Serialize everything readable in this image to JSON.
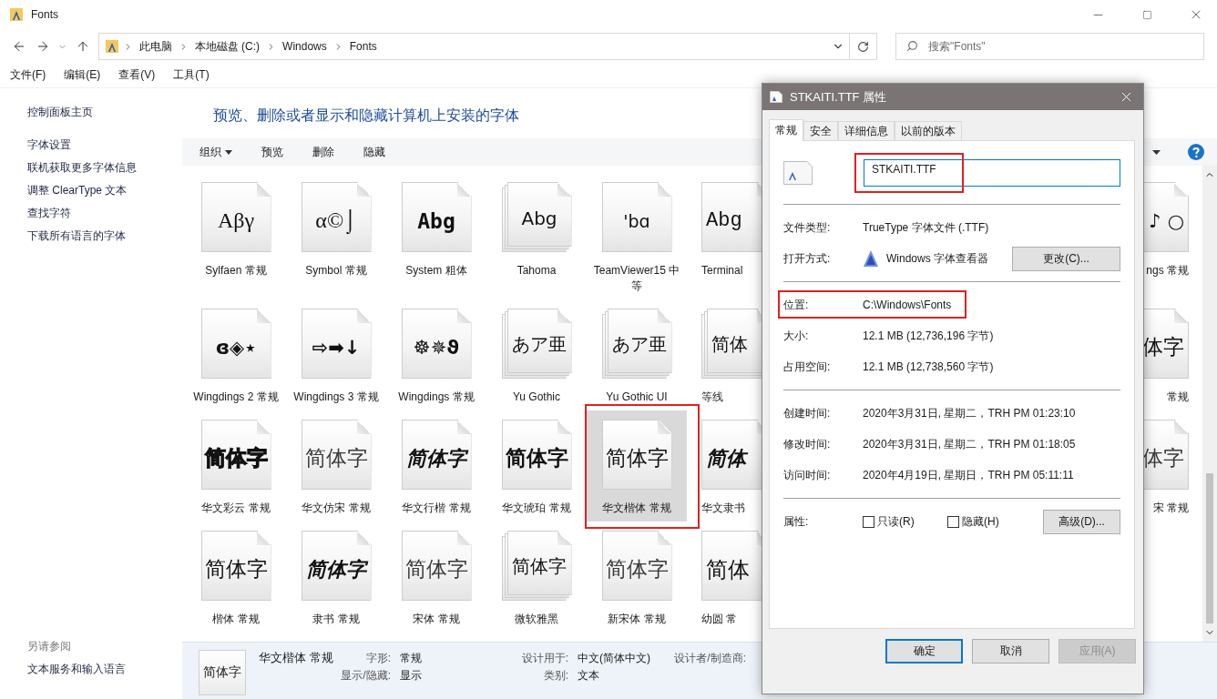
{
  "window": {
    "title": "Fonts"
  },
  "nav": {
    "breadcrumbs": [
      "此电脑",
      "本地磁盘 (C:)",
      "Windows",
      "Fonts"
    ],
    "search": {
      "placeholder": "搜索\"Fonts\""
    }
  },
  "menu": [
    "文件(F)",
    "编辑(E)",
    "查看(V)",
    "工具(T)"
  ],
  "sidebar": {
    "home": "控制面板主页",
    "links": [
      "字体设置",
      "联机获取更多字体信息",
      "调整 ClearType 文本",
      "查找字符",
      "下载所有语言的字体"
    ],
    "see_also": {
      "heading": "另请参阅",
      "links": [
        "文本服务和输入语言"
      ]
    }
  },
  "heading": "预览、删除或者显示和隐藏计算机上安装的字体",
  "toolbar": {
    "organize": "组织",
    "buttons": [
      "预览",
      "删除",
      "隐藏"
    ]
  },
  "font_rows": [
    {
      "items": [
        {
          "kind": "full",
          "label": "Sylfaen 常规",
          "sample": "Aβγ",
          "stacked": false,
          "selected": false,
          "outlined": false
        },
        {
          "kind": "full",
          "label": "Symbol 常规",
          "sample": "α©⌡",
          "stacked": false,
          "selected": false,
          "outlined": false
        },
        {
          "kind": "full",
          "label": "System 粗体",
          "sample": "Abg",
          "stacked": false,
          "selected": false,
          "outlined": false
        },
        {
          "kind": "full",
          "label": "Tahoma",
          "sample": "Abg",
          "stacked": true,
          "selected": false,
          "outlined": false
        },
        {
          "kind": "full",
          "label": "TeamViewer15 中等",
          "sample": "'bɑ",
          "stacked": false,
          "selected": false,
          "outlined": false
        },
        {
          "kind": "cut_right",
          "label": "Terminal",
          "sample": "Abg",
          "stacked": false,
          "selected": false,
          "outlined": false
        },
        {
          "kind": "cut_left",
          "label": "ngs 常规",
          "sample": "♪ ○",
          "stacked": false,
          "selected": false,
          "outlined": false
        }
      ]
    },
    {
      "items": [
        {
          "kind": "full",
          "label": "Wingdings 2 常规",
          "sample": "ɞ◈⋆",
          "stacked": false,
          "selected": false,
          "outlined": false
        },
        {
          "kind": "full",
          "label": "Wingdings 3 常规",
          "sample": "⇨➡↓",
          "stacked": false,
          "selected": false,
          "outlined": false
        },
        {
          "kind": "full",
          "label": "Wingdings 常规",
          "sample": "☸✵ϑ",
          "stacked": false,
          "selected": false,
          "outlined": false
        },
        {
          "kind": "full",
          "label": "Yu Gothic",
          "sample": "あア亜",
          "stacked": true,
          "selected": false,
          "outlined": false
        },
        {
          "kind": "full",
          "label": "Yu Gothic UI",
          "sample": "あア亜",
          "stacked": true,
          "selected": false,
          "outlined": false
        },
        {
          "kind": "cut_right",
          "label": "等线",
          "sample": "简体",
          "stacked": true,
          "selected": false,
          "outlined": false
        },
        {
          "kind": "cut_left",
          "label": "常规",
          "sample": "体字",
          "stacked": false,
          "selected": false,
          "outlined": false
        }
      ]
    },
    {
      "items": [
        {
          "kind": "full",
          "label": "华文彩云 常规",
          "sample": "简体字",
          "stacked": false,
          "selected": false,
          "outlined": false
        },
        {
          "kind": "full",
          "label": "华文仿宋 常规",
          "sample": "简体字",
          "stacked": false,
          "selected": false,
          "outlined": false
        },
        {
          "kind": "full",
          "label": "华文行楷 常规",
          "sample": "简体字",
          "stacked": false,
          "selected": false,
          "outlined": false
        },
        {
          "kind": "full",
          "label": "华文琥珀 常规",
          "sample": "简体字",
          "stacked": false,
          "selected": false,
          "outlined": false
        },
        {
          "kind": "full",
          "label": "华文楷体 常规",
          "sample": "简体字",
          "stacked": false,
          "selected": true,
          "outlined": true
        },
        {
          "kind": "cut_right",
          "label": "华文隶书",
          "sample": "简体",
          "stacked": false,
          "selected": false,
          "outlined": false
        },
        {
          "kind": "cut_left",
          "label": "宋 常规",
          "sample": "体字",
          "stacked": false,
          "selected": false,
          "outlined": false
        }
      ]
    },
    {
      "items": [
        {
          "kind": "full",
          "label": "楷体 常规",
          "sample": "简体字",
          "stacked": false,
          "selected": false,
          "outlined": false
        },
        {
          "kind": "full",
          "label": "隶书 常规",
          "sample": "简体字",
          "stacked": false,
          "selected": false,
          "outlined": false
        },
        {
          "kind": "full",
          "label": "宋体 常规",
          "sample": "简体字",
          "stacked": false,
          "selected": false,
          "outlined": false
        },
        {
          "kind": "full",
          "label": "微软雅黑",
          "sample": "简体字",
          "stacked": true,
          "selected": false,
          "outlined": false
        },
        {
          "kind": "full",
          "label": "新宋体 常规",
          "sample": "简体字",
          "stacked": false,
          "selected": false,
          "outlined": false
        },
        {
          "kind": "cut_right",
          "label": "幼圆 常",
          "sample": "简体",
          "stacked": false,
          "selected": false,
          "outlined": false
        }
      ]
    }
  ],
  "details": {
    "sample": "简体字",
    "name": "华文楷体 常规",
    "groups": [
      [
        {
          "label": "字形:",
          "value": "常规"
        },
        {
          "label": "显示/隐藏:",
          "value": "显示"
        }
      ],
      [
        {
          "label": "设计用于:",
          "value": "中文(简体中文)"
        },
        {
          "label": "类别:",
          "value": "文本"
        }
      ],
      [
        {
          "label": "设计者/制造商:"
        }
      ]
    ]
  },
  "dialog": {
    "title": "STKAITI.TTF 属性",
    "tabs": [
      {
        "label": "常规",
        "selected": true
      },
      {
        "label": "安全",
        "selected": false
      },
      {
        "label": "详细信息",
        "selected": false
      },
      {
        "label": "以前的版本",
        "selected": false
      }
    ],
    "file_name": {
      "value": "STKAITI.TTF",
      "outlined": true
    },
    "sections": [
      [
        {
          "kind": "text",
          "label": "文件类型:",
          "value": "TrueType 字体文件 (.TTF)",
          "outlined": false
        },
        {
          "kind": "app",
          "label": "打开方式:",
          "value": "Windows 字体查看器",
          "button": "更改(C)...",
          "outlined": false
        }
      ],
      [
        {
          "kind": "text",
          "label": "位置:",
          "value": "C:\\Windows\\Fonts",
          "outlined": true
        },
        {
          "kind": "text",
          "label": "大小:",
          "value": "12.1 MB (12,736,196 字节)",
          "outlined": false
        },
        {
          "kind": "text",
          "label": "占用空间:",
          "value": "12.1 MB (12,738,560 字节)",
          "outlined": false
        }
      ],
      [
        {
          "kind": "text",
          "label": "创建时间:",
          "value": "2020年3月31日, 星期二，TRH PM 01:23:10",
          "outlined": false
        },
        {
          "kind": "text",
          "label": "修改时间:",
          "value": "2020年3月31日, 星期二，TRH PM 01:18:05",
          "outlined": false
        },
        {
          "kind": "text",
          "label": "访问时间:",
          "value": "2020年4月19日, 星期日，TRH PM 05:11:11",
          "outlined": false
        }
      ],
      [
        {
          "kind": "attributes",
          "label": "属性:",
          "checkboxes": [
            {
              "label": "只读(R)",
              "checked": false
            },
            {
              "label": "隐藏(H)",
              "checked": false
            }
          ],
          "button": "高级(D)...",
          "outlined": false
        }
      ]
    ],
    "buttons": [
      {
        "label": "确定",
        "default": true,
        "disabled": false
      },
      {
        "label": "取消",
        "default": false,
        "disabled": false
      },
      {
        "label": "应用(A)",
        "default": false,
        "disabled": true
      }
    ]
  }
}
